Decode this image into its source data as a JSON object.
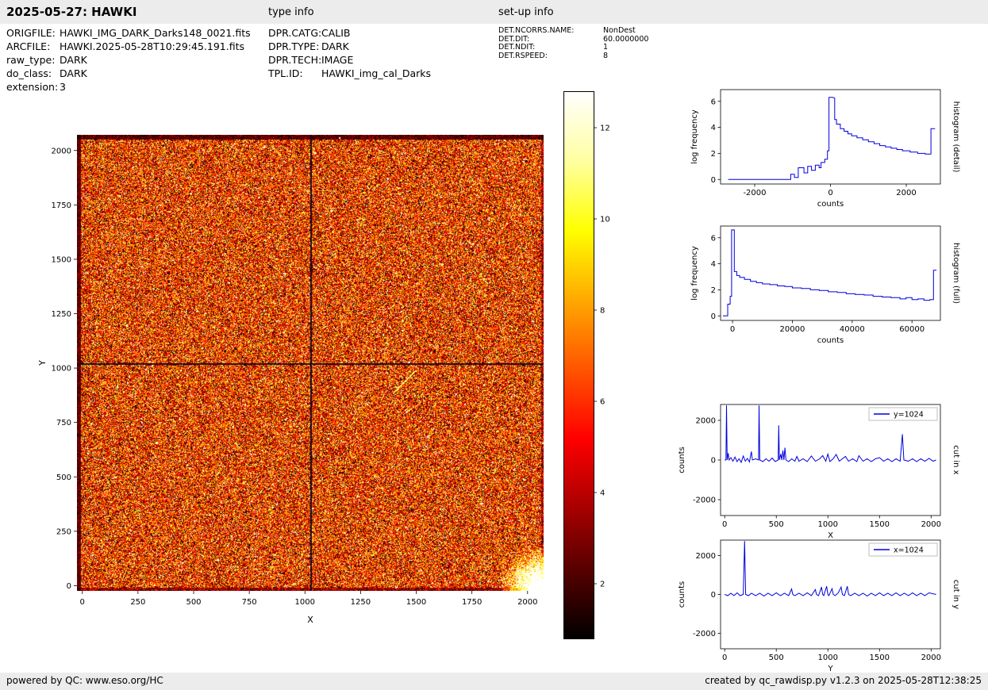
{
  "header": {
    "title": "2025-05-27: HAWKI",
    "type_info_label": "type info",
    "setup_info_label": "set-up info"
  },
  "file_info": {
    "rows": [
      {
        "label": "ORIGFILE:",
        "value": "HAWKI_IMG_DARK_Darks148_0021.fits"
      },
      {
        "label": "ARCFILE:",
        "value": "HAWKI.2025-05-28T10:29:45.191.fits"
      },
      {
        "label": "raw_type:",
        "value": "DARK"
      },
      {
        "label": "do_class:",
        "value": "DARK"
      },
      {
        "label": "extension:",
        "value": "3"
      }
    ]
  },
  "type_info": {
    "rows": [
      {
        "label": "DPR.CATG:",
        "value": "CALIB"
      },
      {
        "label": "DPR.TYPE:",
        "value": "DARK"
      },
      {
        "label": "DPR.TECH:",
        "value": "IMAGE"
      },
      {
        "label": "TPL.ID:",
        "value": "HAWKI_img_cal_Darks"
      }
    ]
  },
  "setup_info": {
    "rows": [
      {
        "label": "DET.NCORRS.NAME:",
        "value": "NonDest"
      },
      {
        "label": "DET.DIT:",
        "value": "60.0000000"
      },
      {
        "label": "DET.NDIT:",
        "value": "1"
      },
      {
        "label": "DET.RSPEED:",
        "value": "8"
      }
    ]
  },
  "footer": {
    "left": "powered by QC: www.eso.org/HC",
    "right": "created by qc_rawdisp.py v1.2.3 on 2025-05-28T12:38:25"
  },
  "chart_data": [
    {
      "id": "detector_image",
      "type": "heatmap",
      "title": "",
      "xlabel": "X",
      "ylabel": "Y",
      "xticks": [
        0,
        250,
        500,
        750,
        1000,
        1250,
        1500,
        1750,
        2000
      ],
      "yticks": [
        0,
        250,
        500,
        750,
        1000,
        1250,
        1500,
        1750,
        2000
      ],
      "xlim": [
        -24,
        2072
      ],
      "ylim": [
        -24,
        2072
      ],
      "colormap": "hot",
      "crosshair": {
        "x": 1024,
        "y": 1024
      },
      "colorbar": {
        "ticks": [
          2,
          4,
          6,
          8,
          10,
          12
        ],
        "vmin": 0.8,
        "vmax": 12.8
      }
    },
    {
      "id": "histogram_detail",
      "type": "line",
      "title": "",
      "xlabel": "counts",
      "ylabel": "log frequency",
      "right_label": "histogram (detail)",
      "xlim": [
        -2900,
        2900
      ],
      "ylim": [
        -0.35,
        6.9
      ],
      "xticks": [
        -2000,
        0,
        2000
      ],
      "yticks": [
        0,
        2,
        4,
        6
      ],
      "line_color": "#0000dd",
      "points": [
        [
          -2700,
          0
        ],
        [
          -1050,
          0
        ],
        [
          -1050,
          0.4
        ],
        [
          -950,
          0.4
        ],
        [
          -950,
          0.15
        ],
        [
          -850,
          0.15
        ],
        [
          -850,
          0.9
        ],
        [
          -700,
          0.9
        ],
        [
          -700,
          0.5
        ],
        [
          -600,
          0.5
        ],
        [
          -600,
          1.0
        ],
        [
          -500,
          1.0
        ],
        [
          -500,
          0.7
        ],
        [
          -400,
          0.7
        ],
        [
          -400,
          1.1
        ],
        [
          -300,
          1.1
        ],
        [
          -300,
          0.9
        ],
        [
          -250,
          0.9
        ],
        [
          -250,
          1.3
        ],
        [
          -150,
          1.3
        ],
        [
          -150,
          1.55
        ],
        [
          -80,
          1.55
        ],
        [
          -80,
          2.2
        ],
        [
          -40,
          2.2
        ],
        [
          -40,
          6.3
        ],
        [
          60,
          6.3
        ],
        [
          110,
          6.25
        ],
        [
          110,
          4.6
        ],
        [
          160,
          4.6
        ],
        [
          160,
          4.25
        ],
        [
          260,
          4.25
        ],
        [
          260,
          3.9
        ],
        [
          360,
          3.9
        ],
        [
          360,
          3.7
        ],
        [
          460,
          3.7
        ],
        [
          460,
          3.5
        ],
        [
          560,
          3.5
        ],
        [
          560,
          3.35
        ],
        [
          700,
          3.35
        ],
        [
          700,
          3.2
        ],
        [
          850,
          3.2
        ],
        [
          850,
          3.05
        ],
        [
          1000,
          3.05
        ],
        [
          1000,
          2.9
        ],
        [
          1150,
          2.9
        ],
        [
          1150,
          2.75
        ],
        [
          1300,
          2.75
        ],
        [
          1300,
          2.6
        ],
        [
          1450,
          2.6
        ],
        [
          1450,
          2.5
        ],
        [
          1600,
          2.5
        ],
        [
          1600,
          2.4
        ],
        [
          1750,
          2.4
        ],
        [
          1750,
          2.3
        ],
        [
          1900,
          2.3
        ],
        [
          1900,
          2.2
        ],
        [
          2100,
          2.2
        ],
        [
          2100,
          2.1
        ],
        [
          2300,
          2.1
        ],
        [
          2300,
          2.0
        ],
        [
          2500,
          2.0
        ],
        [
          2500,
          1.95
        ],
        [
          2650,
          1.95
        ],
        [
          2650,
          3.9
        ],
        [
          2760,
          3.9
        ]
      ]
    },
    {
      "id": "histogram_full",
      "type": "line",
      "title": "",
      "xlabel": "counts",
      "ylabel": "log frequency",
      "right_label": "histogram (full)",
      "xlim": [
        -4000,
        69500
      ],
      "ylim": [
        -0.35,
        6.9
      ],
      "xticks": [
        0,
        20000,
        40000,
        60000
      ],
      "yticks": [
        0,
        2,
        4,
        6
      ],
      "line_color": "#0000dd",
      "points": [
        [
          -3200,
          0
        ],
        [
          -1600,
          0
        ],
        [
          -1600,
          0.9
        ],
        [
          -800,
          0.9
        ],
        [
          -800,
          1.5
        ],
        [
          -300,
          1.5
        ],
        [
          -300,
          6.6
        ],
        [
          600,
          6.6
        ],
        [
          600,
          3.4
        ],
        [
          1400,
          3.4
        ],
        [
          1400,
          3.1
        ],
        [
          2400,
          3.1
        ],
        [
          2400,
          2.95
        ],
        [
          4000,
          2.95
        ],
        [
          4000,
          2.8
        ],
        [
          6000,
          2.8
        ],
        [
          6000,
          2.65
        ],
        [
          8000,
          2.65
        ],
        [
          8000,
          2.55
        ],
        [
          10000,
          2.55
        ],
        [
          10000,
          2.45
        ],
        [
          12500,
          2.45
        ],
        [
          12500,
          2.4
        ],
        [
          15000,
          2.4
        ],
        [
          15000,
          2.3
        ],
        [
          17500,
          2.3
        ],
        [
          17500,
          2.25
        ],
        [
          20000,
          2.25
        ],
        [
          20000,
          2.15
        ],
        [
          23000,
          2.15
        ],
        [
          23000,
          2.1
        ],
        [
          26000,
          2.1
        ],
        [
          26000,
          2.0
        ],
        [
          29000,
          2.0
        ],
        [
          29000,
          1.95
        ],
        [
          32000,
          1.95
        ],
        [
          32000,
          1.85
        ],
        [
          35000,
          1.85
        ],
        [
          35000,
          1.8
        ],
        [
          38000,
          1.8
        ],
        [
          38000,
          1.7
        ],
        [
          41000,
          1.7
        ],
        [
          41000,
          1.65
        ],
        [
          44000,
          1.65
        ],
        [
          44000,
          1.6
        ],
        [
          47000,
          1.6
        ],
        [
          47000,
          1.5
        ],
        [
          50000,
          1.5
        ],
        [
          50000,
          1.45
        ],
        [
          53000,
          1.45
        ],
        [
          53000,
          1.4
        ],
        [
          56000,
          1.4
        ],
        [
          56000,
          1.3
        ],
        [
          58000,
          1.3
        ],
        [
          58000,
          1.4
        ],
        [
          60000,
          1.4
        ],
        [
          60000,
          1.25
        ],
        [
          62000,
          1.25
        ],
        [
          62000,
          1.3
        ],
        [
          64000,
          1.3
        ],
        [
          64000,
          1.2
        ],
        [
          66000,
          1.2
        ],
        [
          66000,
          1.25
        ],
        [
          67200,
          1.25
        ],
        [
          67200,
          3.5
        ],
        [
          68200,
          3.5
        ]
      ]
    },
    {
      "id": "cut_in_x",
      "type": "line",
      "title": "",
      "xlabel": "X",
      "ylabel": "counts",
      "right_label": "cut in x",
      "legend": "y=1024",
      "xlim": [
        -40,
        2090
      ],
      "ylim": [
        -2800,
        2800
      ],
      "xticks": [
        0,
        500,
        1000,
        1500,
        2000
      ],
      "yticks": [
        -2000,
        0,
        2000
      ],
      "line_color": "#0000dd",
      "points": [
        [
          0,
          0
        ],
        [
          12,
          0
        ],
        [
          18,
          2750
        ],
        [
          24,
          0
        ],
        [
          34,
          350
        ],
        [
          42,
          0
        ],
        [
          60,
          120
        ],
        [
          80,
          -60
        ],
        [
          100,
          150
        ],
        [
          120,
          -80
        ],
        [
          140,
          60
        ],
        [
          160,
          -120
        ],
        [
          180,
          200
        ],
        [
          200,
          -60
        ],
        [
          220,
          80
        ],
        [
          240,
          -100
        ],
        [
          258,
          430
        ],
        [
          268,
          0
        ],
        [
          300,
          60
        ],
        [
          328,
          0
        ],
        [
          333,
          2750
        ],
        [
          340,
          0
        ],
        [
          370,
          -80
        ],
        [
          400,
          60
        ],
        [
          430,
          -60
        ],
        [
          460,
          100
        ],
        [
          490,
          -80
        ],
        [
          518,
          0
        ],
        [
          524,
          1750
        ],
        [
          530,
          0
        ],
        [
          544,
          300
        ],
        [
          554,
          0
        ],
        [
          564,
          480
        ],
        [
          574,
          0
        ],
        [
          584,
          620
        ],
        [
          594,
          0
        ],
        [
          620,
          -80
        ],
        [
          650,
          60
        ],
        [
          680,
          -60
        ],
        [
          700,
          180
        ],
        [
          720,
          -60
        ],
        [
          760,
          60
        ],
        [
          800,
          -80
        ],
        [
          840,
          200
        ],
        [
          880,
          -60
        ],
        [
          920,
          60
        ],
        [
          950,
          220
        ],
        [
          980,
          -60
        ],
        [
          1000,
          300
        ],
        [
          1020,
          -80
        ],
        [
          1050,
          60
        ],
        [
          1080,
          280
        ],
        [
          1110,
          -60
        ],
        [
          1140,
          60
        ],
        [
          1170,
          180
        ],
        [
          1200,
          -60
        ],
        [
          1240,
          60
        ],
        [
          1280,
          -80
        ],
        [
          1300,
          220
        ],
        [
          1340,
          -60
        ],
        [
          1380,
          60
        ],
        [
          1420,
          -80
        ],
        [
          1460,
          60
        ],
        [
          1500,
          120
        ],
        [
          1540,
          -60
        ],
        [
          1580,
          60
        ],
        [
          1620,
          -80
        ],
        [
          1660,
          60
        ],
        [
          1700,
          -60
        ],
        [
          1722,
          1300
        ],
        [
          1736,
          0
        ],
        [
          1780,
          -60
        ],
        [
          1820,
          60
        ],
        [
          1860,
          -80
        ],
        [
          1900,
          60
        ],
        [
          1940,
          -60
        ],
        [
          1980,
          80
        ],
        [
          2020,
          -60
        ],
        [
          2048,
          0
        ]
      ]
    },
    {
      "id": "cut_in_y",
      "type": "line",
      "title": "",
      "xlabel": "Y",
      "ylabel": "counts",
      "right_label": "cut in y",
      "legend": "x=1024",
      "xlim": [
        -40,
        2090
      ],
      "ylim": [
        -2800,
        2800
      ],
      "xticks": [
        0,
        500,
        1000,
        1500,
        2000
      ],
      "yticks": [
        -2000,
        0,
        2000
      ],
      "line_color": "#0000dd",
      "points": [
        [
          0,
          0
        ],
        [
          30,
          -60
        ],
        [
          60,
          60
        ],
        [
          90,
          -60
        ],
        [
          120,
          80
        ],
        [
          150,
          -60
        ],
        [
          180,
          0
        ],
        [
          193,
          2750
        ],
        [
          203,
          0
        ],
        [
          230,
          -60
        ],
        [
          260,
          60
        ],
        [
          300,
          -60
        ],
        [
          340,
          60
        ],
        [
          380,
          -80
        ],
        [
          420,
          60
        ],
        [
          460,
          -60
        ],
        [
          500,
          80
        ],
        [
          540,
          -60
        ],
        [
          580,
          60
        ],
        [
          620,
          -60
        ],
        [
          648,
          280
        ],
        [
          660,
          0
        ],
        [
          680,
          -60
        ],
        [
          720,
          60
        ],
        [
          760,
          -60
        ],
        [
          800,
          80
        ],
        [
          840,
          -60
        ],
        [
          878,
          250
        ],
        [
          890,
          0
        ],
        [
          910,
          -60
        ],
        [
          938,
          380
        ],
        [
          950,
          0
        ],
        [
          960,
          -60
        ],
        [
          988,
          420
        ],
        [
          1000,
          0
        ],
        [
          1010,
          -60
        ],
        [
          1040,
          300
        ],
        [
          1052,
          0
        ],
        [
          1070,
          -60
        ],
        [
          1100,
          80
        ],
        [
          1128,
          380
        ],
        [
          1140,
          0
        ],
        [
          1160,
          -60
        ],
        [
          1188,
          420
        ],
        [
          1200,
          0
        ],
        [
          1220,
          -60
        ],
        [
          1260,
          60
        ],
        [
          1300,
          -60
        ],
        [
          1340,
          60
        ],
        [
          1380,
          -80
        ],
        [
          1420,
          60
        ],
        [
          1460,
          -60
        ],
        [
          1500,
          80
        ],
        [
          1540,
          -60
        ],
        [
          1580,
          60
        ],
        [
          1620,
          -60
        ],
        [
          1660,
          80
        ],
        [
          1700,
          -60
        ],
        [
          1740,
          60
        ],
        [
          1780,
          -60
        ],
        [
          1820,
          80
        ],
        [
          1860,
          -60
        ],
        [
          1900,
          60
        ],
        [
          1940,
          -60
        ],
        [
          1980,
          80
        ],
        [
          2048,
          0
        ]
      ]
    }
  ]
}
